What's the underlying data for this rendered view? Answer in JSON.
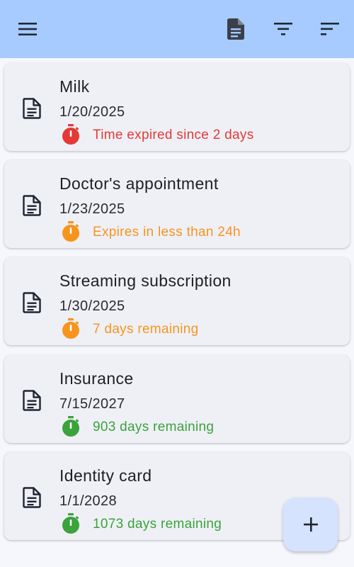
{
  "toolbar": {
    "menu_icon": "menu-icon",
    "document_icon": "document-icon",
    "filter_icon": "filter-icon",
    "sort_icon": "sort-icon"
  },
  "items": [
    {
      "title": "Milk",
      "date": "1/20/2025",
      "status": "Time expired since 2 days",
      "color": "#e53935"
    },
    {
      "title": "Doctor's appointment",
      "date": "1/23/2025",
      "status": "Expires in less than 24h",
      "color": "#f7941d"
    },
    {
      "title": "Streaming subscription",
      "date": "1/30/2025",
      "status": "7 days remaining",
      "color": "#f7941d"
    },
    {
      "title": "Insurance",
      "date": "7/15/2027",
      "status": "903 days remaining",
      "color": "#3aa33a"
    },
    {
      "title": "Identity card",
      "date": "1/1/2028",
      "status": "1073 days remaining",
      "color": "#3aa33a"
    }
  ],
  "fab": {
    "icon": "plus-icon"
  },
  "colors": {
    "appbar": "#a7cbff",
    "background": "#f6f7fc",
    "card": "#eff0f6",
    "fab": "#d6e3ff"
  }
}
